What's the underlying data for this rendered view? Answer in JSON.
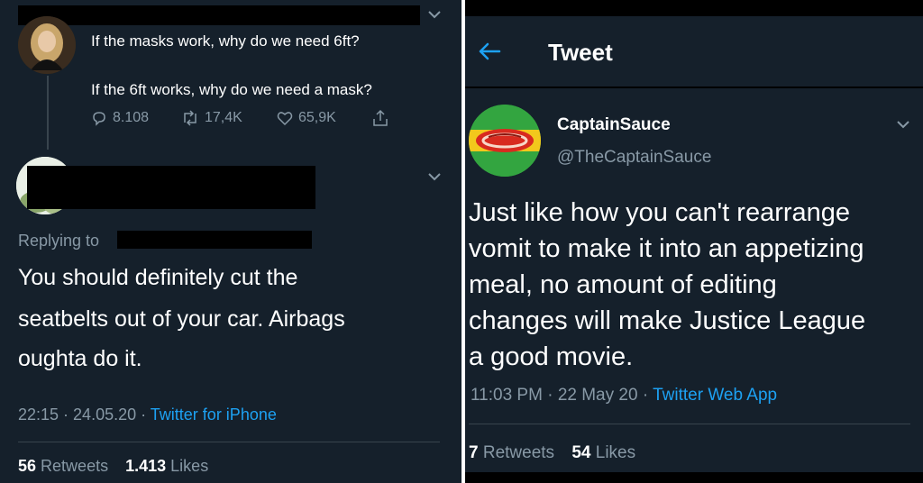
{
  "left": {
    "quoted_tweet": {
      "line1": "If the masks work, why do we need 6ft?",
      "line2": "If the 6ft works, why do we need a mask?",
      "replies": "8.108",
      "retweets": "17,4K",
      "likes": "65,9K"
    },
    "reply": {
      "replying_to_label": "Replying to",
      "body_lines": [
        "You should definitely cut the",
        "seatbelts out of your car. Airbags",
        "oughta do it."
      ],
      "time": "22:15",
      "date": "24.05.20",
      "source": "Twitter for iPhone",
      "retweet_count": "56",
      "retweet_label": "Retweets",
      "like_count": "1.413",
      "like_label": "Likes"
    }
  },
  "right": {
    "header_title": "Tweet",
    "display_name": "CaptainSauce",
    "handle": "@TheCaptainSauce",
    "body_lines": [
      "Just like how you can't rearrange",
      "vomit to make it into an appetizing",
      "meal, no amount of editing",
      "changes will make Justice League",
      "a good movie."
    ],
    "time": "11:03 PM",
    "date": "22 May 20",
    "source": "Twitter Web App",
    "retweet_count": "7",
    "retweet_label": "Retweets",
    "like_count": "54",
    "like_label": "Likes"
  },
  "colors": {
    "background": "#15202b",
    "muted_text": "#8899a6",
    "link_blue": "#1da1f2",
    "divider": "#38444d"
  }
}
